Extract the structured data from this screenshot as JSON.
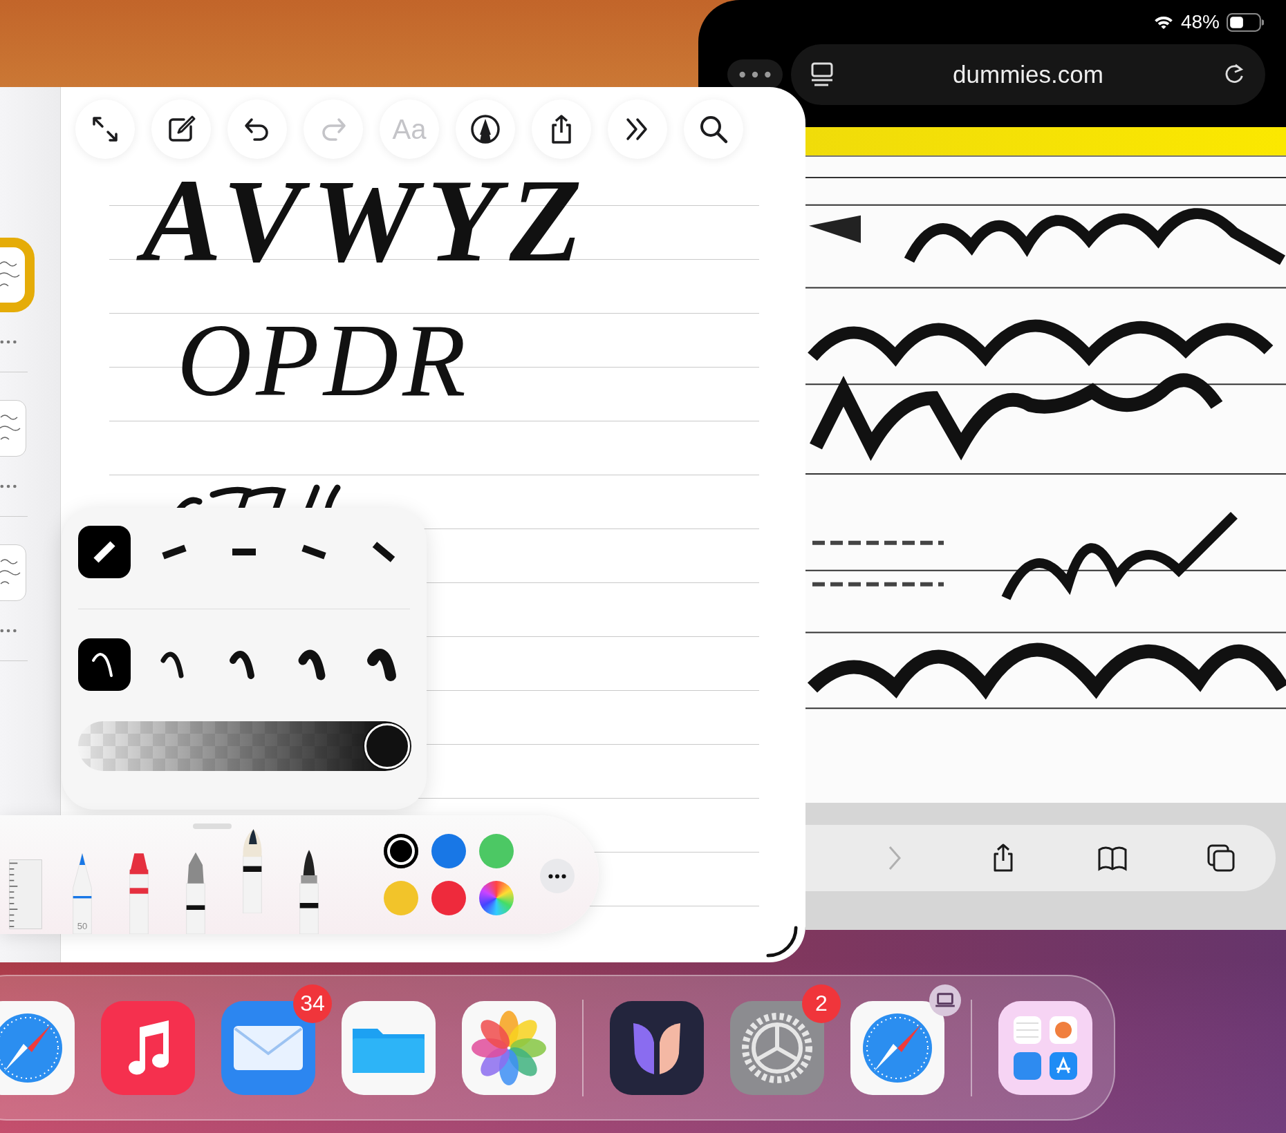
{
  "status_bar": {
    "battery": "48%"
  },
  "browser": {
    "address": "dummies.com",
    "toolbar": [
      {
        "kind": "forward",
        "disabled": true
      },
      {
        "kind": "share",
        "disabled": false
      },
      {
        "kind": "bookmarks",
        "disabled": false
      },
      {
        "kind": "tabs",
        "disabled": false
      }
    ]
  },
  "notes": {
    "sidebar": [
      {
        "selected": true
      },
      {
        "selected": false
      },
      {
        "selected": false
      }
    ],
    "toolbar": [
      {
        "kind": "resize",
        "disabled": false
      },
      {
        "kind": "compose",
        "disabled": false
      },
      {
        "kind": "undo",
        "disabled": false
      },
      {
        "kind": "redo",
        "disabled": true
      },
      {
        "kind": "text",
        "label": "Aa",
        "disabled": true
      },
      {
        "kind": "markup",
        "disabled": false
      },
      {
        "kind": "share",
        "disabled": false
      },
      {
        "kind": "more",
        "disabled": false
      },
      {
        "kind": "search",
        "disabled": false
      }
    ],
    "handwriting": [
      "AVWYZ",
      "OPDR"
    ]
  },
  "pen_options": {
    "angles": [
      {
        "selected": true
      },
      {
        "selected": false
      },
      {
        "selected": false
      },
      {
        "selected": false
      },
      {
        "selected": false
      }
    ],
    "widths": [
      {
        "selected": true
      },
      {
        "selected": false
      },
      {
        "selected": false
      },
      {
        "selected": false
      },
      {
        "selected": false
      }
    ],
    "opacity": {
      "level": 1
    }
  },
  "tool_palette": {
    "tools": [
      {
        "kind": "ruler",
        "selected": false
      },
      {
        "kind": "pencil",
        "label": "50",
        "selected": false
      },
      {
        "kind": "crayon",
        "selected": false
      },
      {
        "kind": "fountain_pen",
        "selected": false
      },
      {
        "kind": "brush",
        "selected": true
      },
      {
        "kind": "marker",
        "selected": false
      }
    ],
    "colors": [
      {
        "kind": "swatch",
        "color": "#000000",
        "selected": true
      },
      {
        "kind": "swatch",
        "color": "#1877e6",
        "selected": false
      },
      {
        "kind": "swatch",
        "color": "#4cc864",
        "selected": false
      },
      {
        "kind": "swatch",
        "color": "#f2c42a",
        "selected": false
      },
      {
        "kind": "swatch",
        "color": "#ee2a3c",
        "selected": false
      },
      {
        "kind": "wheel",
        "selected": false
      }
    ]
  },
  "dock": {
    "groups": [
      [
        {
          "kind": "compass",
          "handoff": false
        },
        {
          "kind": "music",
          "handoff": false
        },
        {
          "kind": "mail",
          "badge": "34",
          "handoff": false
        },
        {
          "kind": "files",
          "handoff": false
        },
        {
          "kind": "photos",
          "handoff": false
        }
      ],
      [
        {
          "kind": "butterfly",
          "handoff": false
        },
        {
          "kind": "settings",
          "badge": "2",
          "handoff": false
        },
        {
          "kind": "compass",
          "handoff": true
        }
      ],
      [
        {
          "kind": "folder",
          "handoff": false
        }
      ]
    ]
  }
}
